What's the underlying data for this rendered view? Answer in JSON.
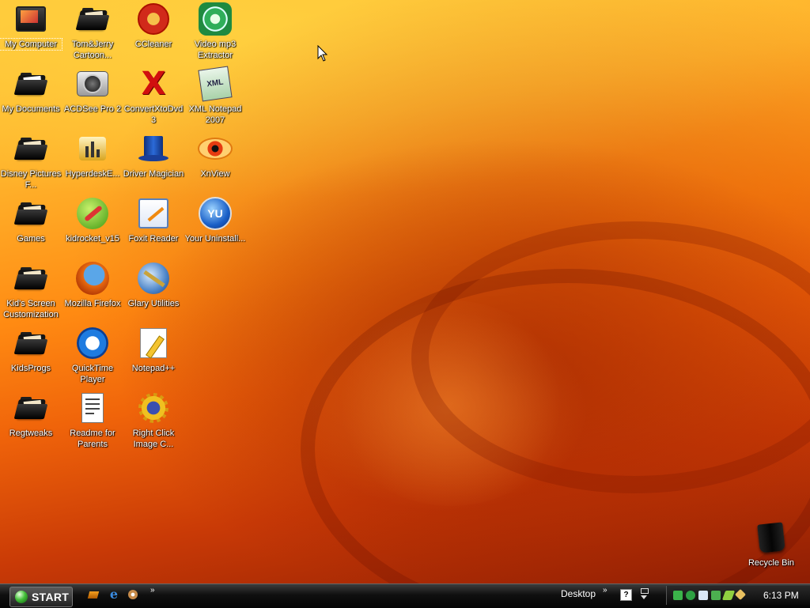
{
  "desktop": {
    "icons": [
      {
        "label": "My Computer",
        "icon": "my-computer-icon"
      },
      {
        "label": "Tom&Jerry Cartoon...",
        "icon": "folder-icon"
      },
      {
        "label": "CCleaner",
        "icon": "ccleaner-icon"
      },
      {
        "label": "Video mp3 Extractor",
        "icon": "video-mp3-extractor-icon"
      },
      {
        "label": "My Documents",
        "icon": "my-documents-icon"
      },
      {
        "label": "ACDSee Pro 2",
        "icon": "camera-icon"
      },
      {
        "label": "ConvertXtoDvd 3",
        "icon": "convertxtodvd-icon"
      },
      {
        "label": "XML Notepad 2007",
        "icon": "xml-notepad-icon"
      },
      {
        "label": "Disney Pictures F...",
        "icon": "folder-icon"
      },
      {
        "label": "HyperdeskE...",
        "icon": "hyperdesk-icon"
      },
      {
        "label": "Driver Magician",
        "icon": "magician-hat-icon"
      },
      {
        "label": "XnView",
        "icon": "xnview-eye-icon"
      },
      {
        "label": "Games",
        "icon": "folder-icon"
      },
      {
        "label": "kidrocket_v15",
        "icon": "rocket-icon"
      },
      {
        "label": "Foxit Reader",
        "icon": "foxit-reader-icon"
      },
      {
        "label": "Your Uninstall...",
        "icon": "your-uninstaller-icon"
      },
      {
        "label": "Kid's Screen Customization",
        "icon": "folder-icon"
      },
      {
        "label": "Mozilla Firefox",
        "icon": "firefox-icon"
      },
      {
        "label": "Glary Utilities",
        "icon": "glary-utilities-icon"
      },
      {
        "label": "KidsProgs",
        "icon": "folder-icon"
      },
      {
        "label": "QuickTime Player",
        "icon": "quicktime-icon"
      },
      {
        "label": "Notepad++",
        "icon": "notepad-plus-icon"
      },
      {
        "label": "Regtweaks",
        "icon": "folder-icon"
      },
      {
        "label": "Readme for Parents",
        "icon": "text-document-icon"
      },
      {
        "label": "Right Click Image C...",
        "icon": "gear-sun-icon"
      }
    ],
    "recycle_bin": {
      "label": "Recycle Bin",
      "icon": "recycle-bin-icon"
    }
  },
  "taskbar": {
    "start_label": "START",
    "quick_launch": [
      "show-desktop-icon",
      "internet-explorer-icon",
      "media-icon"
    ],
    "quick_launch_more": "»",
    "toolbar_label": "Desktop",
    "toolbar_more": "»",
    "clock": "6:13 PM"
  },
  "colors": {
    "wallpaper_top": "#ffc93a",
    "wallpaper_mid": "#f0640a",
    "wallpaper_bottom": "#8e1d03",
    "taskbar": "#0f0f0f",
    "start_orb": "#45c03a"
  }
}
